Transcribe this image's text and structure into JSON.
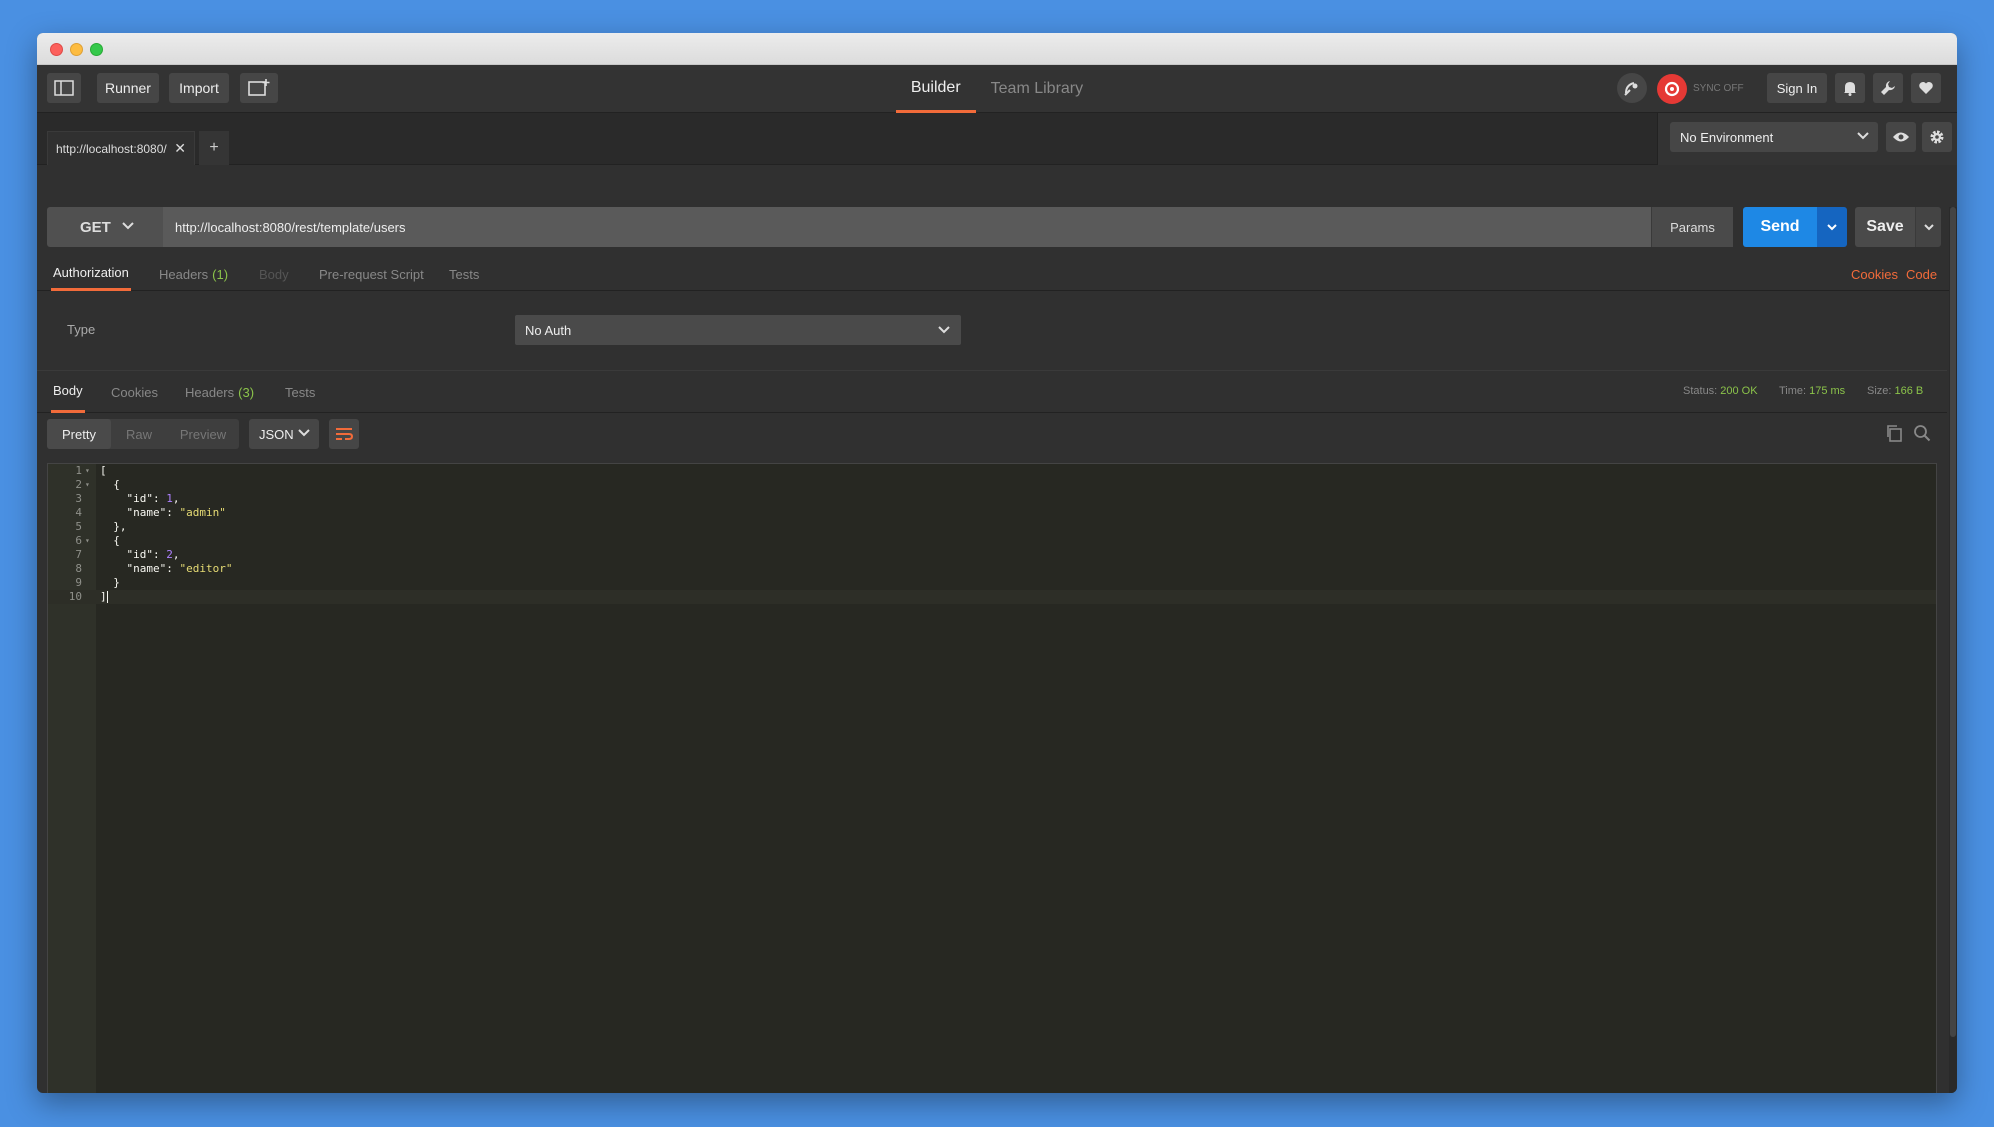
{
  "header": {
    "runner_label": "Runner",
    "import_label": "Import",
    "tabs": [
      {
        "label": "Builder"
      },
      {
        "label": "Team Library"
      }
    ],
    "sync_label": "SYNC OFF",
    "signin_label": "Sign In"
  },
  "request_tab": {
    "label": "http://localhost:8080/",
    "close": "✕",
    "add": "+"
  },
  "environment": {
    "selected": "No Environment"
  },
  "request": {
    "method": "GET",
    "url": "http://localhost:8080/rest/template/users",
    "params_label": "Params",
    "send_label": "Send",
    "save_label": "Save"
  },
  "request_tabs": {
    "authorization": "Authorization",
    "headers": "Headers",
    "headers_count": "(1)",
    "body": "Body",
    "prerequest": "Pre-request Script",
    "tests": "Tests",
    "cookies_link": "Cookies",
    "code_link": "Code"
  },
  "auth": {
    "type_label": "Type",
    "type_value": "No Auth"
  },
  "response": {
    "tabs": {
      "body": "Body",
      "cookies": "Cookies",
      "headers": "Headers",
      "headers_count": "(3)",
      "tests": "Tests"
    },
    "status_label": "Status:",
    "status_value": "200 OK",
    "time_label": "Time:",
    "time_value": "175 ms",
    "size_label": "Size:",
    "size_value": "166 B",
    "format": {
      "pretty": "Pretty",
      "raw": "Raw",
      "preview": "Preview",
      "type": "JSON"
    }
  },
  "code_lines": [
    {
      "n": "1",
      "fold": true
    },
    {
      "n": "2",
      "fold": true
    },
    {
      "n": "3",
      "fold": false
    },
    {
      "n": "4",
      "fold": false
    },
    {
      "n": "5",
      "fold": false
    },
    {
      "n": "6",
      "fold": true
    },
    {
      "n": "7",
      "fold": false
    },
    {
      "n": "8",
      "fold": false
    },
    {
      "n": "9",
      "fold": false
    },
    {
      "n": "10",
      "fold": false
    }
  ],
  "code": {
    "l1": "[",
    "l2": "  {",
    "key_id": "\"id\"",
    "key_name": "\"name\"",
    "colon": ": ",
    "v1": "1",
    "v2": "2",
    "name1": "\"admin\"",
    "name2": "\"editor\"",
    "comma": ",",
    "close_obj_comma": "  },",
    "open_obj": "  {",
    "close_obj": "  }",
    "close_arr": "]",
    "indent": "    "
  },
  "colors": {
    "accent": "#f26b3a",
    "send": "#1e88e5",
    "success": "#8bc34a"
  }
}
